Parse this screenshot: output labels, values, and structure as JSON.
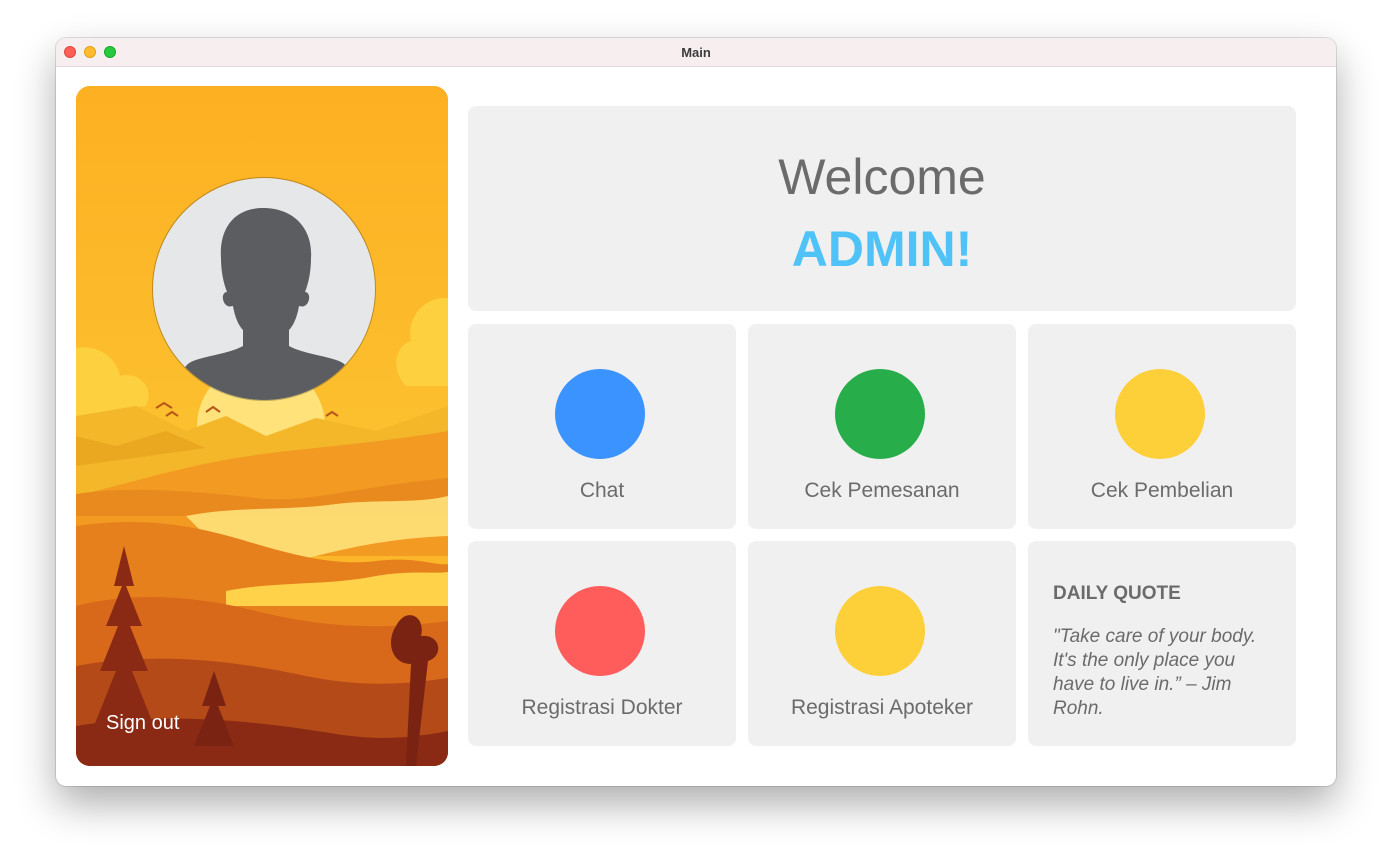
{
  "window": {
    "title": "Main"
  },
  "sidebar": {
    "signout_label": "Sign out",
    "avatar": "user-silhouette-icon"
  },
  "welcome": {
    "greeting": "Welcome",
    "user": "ADMIN!"
  },
  "menu": [
    {
      "label": "Chat",
      "color": "#3a93ff"
    },
    {
      "label": "Cek Pemesanan",
      "color": "#27ae4a"
    },
    {
      "label": "Cek Pembelian",
      "color": "#fdd03a"
    },
    {
      "label": "Registrasi Dokter",
      "color": "#ff5c5c"
    },
    {
      "label": "Registrasi Apoteker",
      "color": "#fdd03a"
    }
  ],
  "quote": {
    "title": "DAILY QUOTE",
    "text": "\"Take care of your body. It's the only place you have to live in.” – Jim Rohn."
  },
  "colors": {
    "accent": "#4fc3f7",
    "card": "#f0f0f0",
    "text": "#6b6b6b"
  }
}
